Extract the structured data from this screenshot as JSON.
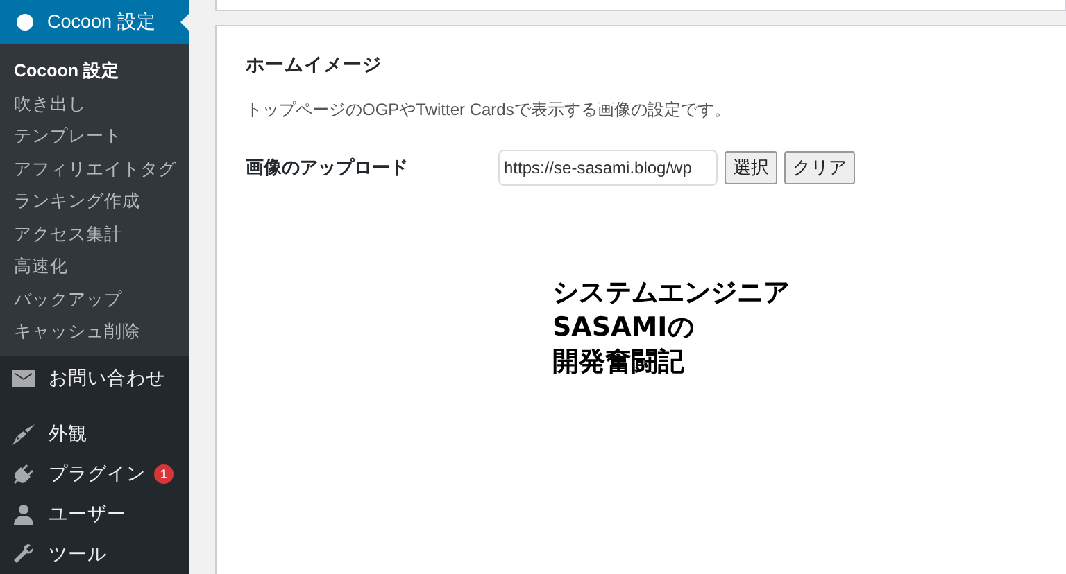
{
  "sidebar": {
    "current_menu": {
      "label": "Cocoon 設定",
      "selected": true
    },
    "submenu": [
      {
        "label": "Cocoon 設定",
        "selected": true
      },
      {
        "label": "吹き出し",
        "selected": false
      },
      {
        "label": "テンプレート",
        "selected": false
      },
      {
        "label": "アフィリエイトタグ",
        "selected": false
      },
      {
        "label": "ランキング作成",
        "selected": false
      },
      {
        "label": "アクセス集計",
        "selected": false
      },
      {
        "label": "高速化",
        "selected": false
      },
      {
        "label": "バックアップ",
        "selected": false
      },
      {
        "label": "キャッシュ削除",
        "selected": false
      }
    ],
    "menu": [
      {
        "label": "お問い合わせ"
      },
      {
        "label": "外観"
      },
      {
        "label": "プラグイン",
        "badge": "1"
      },
      {
        "label": "ユーザー"
      },
      {
        "label": "ツール"
      }
    ]
  },
  "section": {
    "title": "ホームイメージ",
    "description": "トップページのOGPやTwitter Cardsで表示する画像の設定です。",
    "upload": {
      "label": "画像のアップロード",
      "value": "https://se-sasami.blog/wp",
      "buttons": [
        "選択",
        "クリア"
      ]
    },
    "preview_lines": [
      "システムエンジニア",
      "SASAMIの",
      "開発奮闘記"
    ]
  }
}
